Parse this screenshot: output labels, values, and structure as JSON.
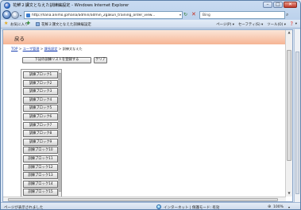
{
  "window": {
    "title": "花鮮２課文となえた訓練編設定 - Windows Internet Explorer"
  },
  "addressbar": {
    "url": "http://hana.animo.jp/hana/admin/admin_2gakun_training_order_view...",
    "search_label": "Bing"
  },
  "favorites": {
    "label": "お気に入り",
    "tab_title": "花鮮２課文となえた訓練編設定",
    "commands": [
      "ページ(P) ▾",
      "セーフティ(S) ▾",
      "ツール(O) ▾",
      "❓ ▾"
    ]
  },
  "page": {
    "header_title": "戻る",
    "breadcrumb": {
      "links": [
        "TOP",
        "ユーザ管理",
        "課長設定"
      ],
      "current": "訓練文なえた"
    },
    "save_button": "下記の訓練リストを登録する",
    "clear_button": "クリア",
    "blocks": [
      "訓練ブロック1",
      "訓練ブロック2",
      "訓練ブロック3",
      "訓練ブロック4",
      "訓練ブロック5",
      "訓練ブロック6",
      "訓練ブロック7",
      "訓練ブロック8",
      "訓練ブロック9",
      "訓練ブロック10",
      "訓練ブロック11",
      "訓練ブロック12",
      "訓練ブロック13",
      "訓練ブロック14",
      "訓練ブロック15"
    ]
  },
  "statusbar": {
    "status": "ページが表示されました",
    "zone": "インターネット | 保護モード: 有効",
    "zoom": "100%"
  }
}
